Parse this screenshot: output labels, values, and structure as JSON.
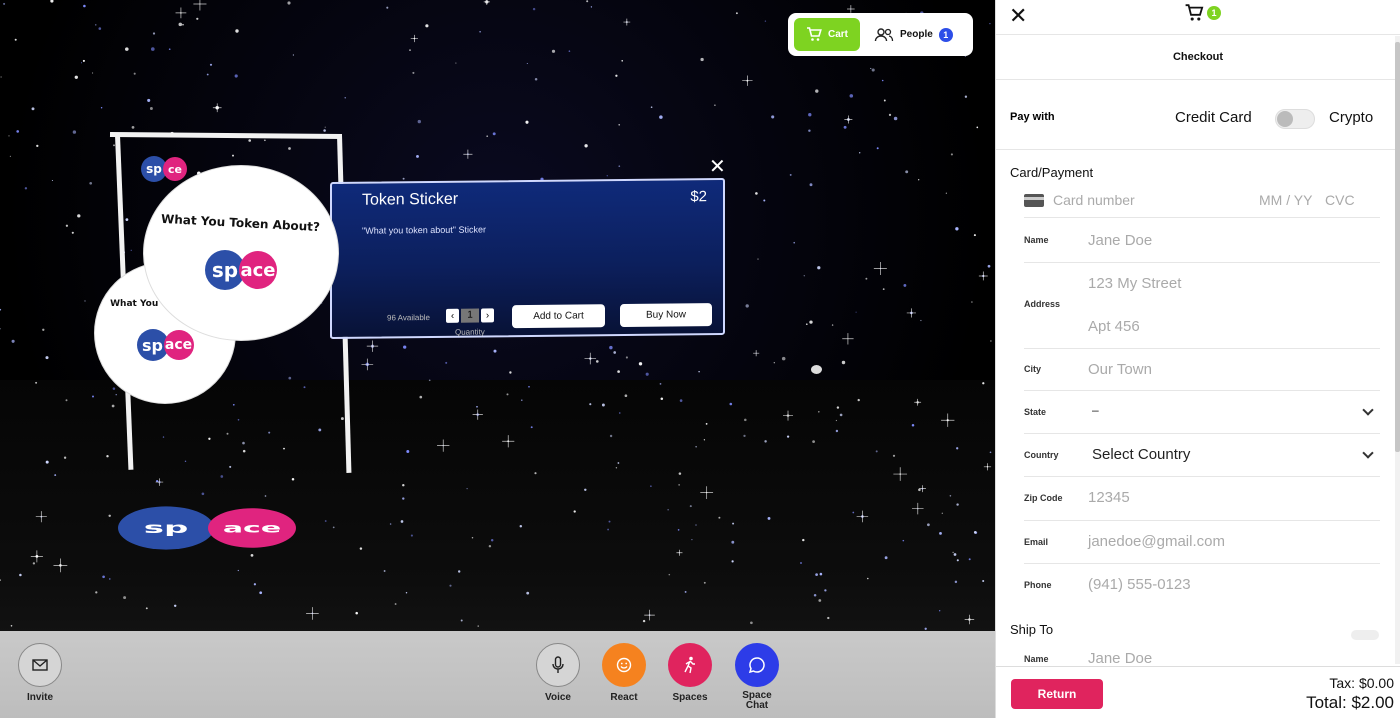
{
  "scene": {
    "product": {
      "title": "Token Sticker",
      "price": "$2",
      "description": "\"What you token about\" Sticker",
      "available": "96 Available",
      "quantity": "1",
      "quantity_label": "Quantity",
      "add_to_cart_label": "Add to Cart",
      "buy_now_label": "Buy Now"
    },
    "sticker_text": "What You Token About?",
    "sticker_text_small": "What You Token Abou",
    "logo_left": "sp",
    "logo_right": "ace",
    "logo_left_small": "sp",
    "logo_right_small": "ce"
  },
  "top_pill": {
    "cart_label": "Cart",
    "people_label": "People",
    "people_count": "1"
  },
  "bottom_bar": {
    "invite_label": "Invite",
    "voice_label": "Voice",
    "react_label": "React",
    "spaces_label": "Spaces",
    "space_chat_label": "Space\nChat"
  },
  "checkout": {
    "cart_count": "1",
    "title": "Checkout",
    "pay_with_label": "Pay with",
    "credit_card_label": "Credit Card",
    "crypto_label": "Crypto",
    "card_section_title": "Card/Payment",
    "card_number_placeholder": "Card number",
    "card_exp_placeholder": "MM / YY",
    "card_cvc_placeholder": "CVC",
    "fields": {
      "name_label": "Name",
      "name_placeholder": "Jane Doe",
      "address_label": "Address",
      "address1_placeholder": "123 My Street",
      "address2_placeholder": "Apt 456",
      "city_label": "City",
      "city_placeholder": "Our Town",
      "state_label": "State",
      "state_value": "–",
      "country_label": "Country",
      "country_value": "Select Country",
      "zip_label": "Zip Code",
      "zip_placeholder": "12345",
      "email_label": "Email",
      "email_placeholder": "janedoe@gmail.com",
      "phone_label": "Phone",
      "phone_placeholder": "(941) 555-0123"
    },
    "ship_to_title": "Ship To",
    "ship_name_label": "Name",
    "ship_name_placeholder": "Jane Doe",
    "return_label": "Return",
    "tax": "Tax: $0.00",
    "total": "Total: $2.00"
  },
  "colors": {
    "accent_green": "#7ed321",
    "return_pink": "#e0245e",
    "react_orange": "#f5821f",
    "spaces_red": "#e0245e",
    "chat_blue": "#2d3ce8",
    "people_badge": "#2d4ee8"
  }
}
